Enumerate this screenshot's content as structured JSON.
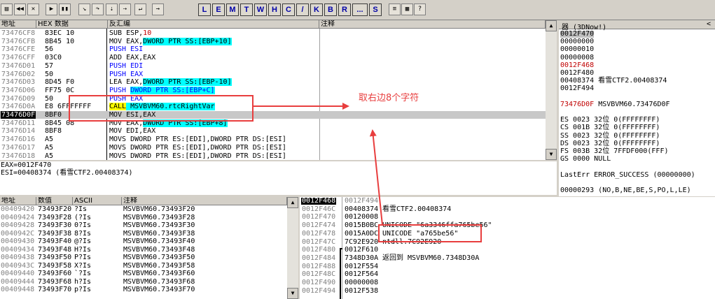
{
  "toolbar": {
    "left_buttons": [
      "open-icon",
      "rewind-icon",
      "close-icon",
      "run-icon",
      "pause-icon",
      "step-into-icon",
      "step-over-icon",
      "trace-into-icon",
      "trace-over-icon",
      "execute-till-return-icon",
      "go-to-icon"
    ],
    "letters": [
      "L",
      "E",
      "M",
      "T",
      "W",
      "H",
      "C",
      "/",
      "K",
      "B",
      "R",
      "...",
      "S"
    ],
    "right_buttons": [
      "list-icon",
      "palette-icon",
      "help-icon"
    ]
  },
  "disasm": {
    "headers": {
      "address": "地址",
      "hex": "HEX 数据",
      "disasm": "反汇编",
      "comment": "注释"
    },
    "rows": [
      {
        "addr": "73476CF8",
        "hex": "83EC 10",
        "pre": "SUB ESP,",
        "hl": "",
        "post": "",
        "num": "10",
        "style": "num"
      },
      {
        "addr": "73476CFB",
        "hex": "8B45 10",
        "pre": "MOV EAX,",
        "hl": "DWORD PTR SS:[EBP+10]",
        "post": "",
        "num": "",
        "style": "cyan"
      },
      {
        "addr": "73476CFE",
        "hex": "56",
        "pre": "PUSH ESI",
        "hl": "",
        "post": "",
        "num": "",
        "style": "blue"
      },
      {
        "addr": "73476CFF",
        "hex": "03C0",
        "pre": "ADD EAX,EAX",
        "hl": "",
        "post": "",
        "num": "",
        "style": "plain"
      },
      {
        "addr": "73476D01",
        "hex": "57",
        "pre": "PUSH EDI",
        "hl": "",
        "post": "",
        "num": "",
        "style": "blue"
      },
      {
        "addr": "73476D02",
        "hex": "50",
        "pre": "PUSH EAX",
        "hl": "",
        "post": "",
        "num": "",
        "style": "blue"
      },
      {
        "addr": "73476D03",
        "hex": "8D45 F0",
        "pre": "LEA EAX,",
        "hl": "DWORD PTR SS:[EBP-10]",
        "post": "",
        "num": "",
        "style": "cyan"
      },
      {
        "addr": "73476D06",
        "hex": "FF75 0C",
        "pre": "PUSH ",
        "hl": "DWORD PTR SS:[EBP+C]",
        "post": "",
        "num": "",
        "style": "cyan-blue"
      },
      {
        "addr": "73476D09",
        "hex": "50",
        "pre": "PUSH EAX",
        "hl": "",
        "post": "",
        "num": "",
        "style": "blue"
      },
      {
        "addr": "73476D0A",
        "hex": "E8 6FFFFFFF",
        "pre": "CALL",
        "hl": " MSVBVM60.rtcRightVar",
        "post": "",
        "num": "",
        "style": "call"
      },
      {
        "addr": "73476D0F",
        "hex": "8BF0",
        "pre": "MOV ESI,EAX",
        "hl": "",
        "post": "",
        "num": "",
        "style": "selected"
      },
      {
        "addr": "73476D11",
        "hex": "8B45 08",
        "pre": "MOV EAX,",
        "hl": "DWORD PTR SS:[EBP+8]",
        "post": "",
        "num": "",
        "style": "cyan"
      },
      {
        "addr": "73476D14",
        "hex": "8BF8",
        "pre": "MOV EDI,EAX",
        "hl": "",
        "post": "",
        "num": "",
        "style": "plain"
      },
      {
        "addr": "73476D16",
        "hex": "A5",
        "pre": "MOVS DWORD PTR ES:[EDI],DWORD PTR DS:[ESI]",
        "hl": "",
        "post": "",
        "num": "",
        "style": "plain"
      },
      {
        "addr": "73476D17",
        "hex": "A5",
        "pre": "MOVS DWORD PTR ES:[EDI],DWORD PTR DS:[ESI]",
        "hl": "",
        "post": "",
        "num": "",
        "style": "plain"
      },
      {
        "addr": "73476D18",
        "hex": "A5",
        "pre": "MOVS DWORD PTR ES:[EDI],DWORD PTR DS:[ESI]",
        "hl": "",
        "post": "",
        "num": "",
        "style": "plain"
      }
    ]
  },
  "info": {
    "line1": "EAX=0012F470",
    "line2": "ESI=00408374 (看雪CTF2.00408374)"
  },
  "registers": {
    "title": "器 (3DNow!)",
    "collapse": "<",
    "lines": [
      {
        "text": "0012F470",
        "style": "sel"
      },
      {
        "text": "00000000",
        "style": "plain"
      },
      {
        "text": "00000010",
        "style": "plain"
      },
      {
        "text": "00000008",
        "style": "plain"
      },
      {
        "text": "0012F468",
        "style": "red"
      },
      {
        "text": "0012F480",
        "style": "plain"
      },
      {
        "text": "00408374 看雪CTF2.00408374",
        "style": "plain"
      },
      {
        "text": "0012F494",
        "style": "plain"
      },
      {
        "text": "",
        "style": "plain"
      },
      {
        "text": "73476D0F MSVBVM60.73476D0F",
        "style": "redaddr"
      },
      {
        "text": "",
        "style": "plain"
      },
      {
        "text": "ES 0023 32位 0(FFFFFFFF)",
        "style": "plain"
      },
      {
        "text": "CS 001B 32位 0(FFFFFFFF)",
        "style": "plain"
      },
      {
        "text": "SS 0023 32位 0(FFFFFFFF)",
        "style": "plain"
      },
      {
        "text": "DS 0023 32位 0(FFFFFFFF)",
        "style": "plain"
      },
      {
        "text": "FS 003B 32位 7FFDF000(FFF)",
        "style": "plain"
      },
      {
        "text": "GS 0000 NULL",
        "style": "plain"
      },
      {
        "text": "",
        "style": "plain"
      },
      {
        "text": "LastErr ERROR_SUCCESS (00000000)",
        "style": "plain"
      },
      {
        "text": "",
        "style": "plain"
      },
      {
        "text": "00000293 (NO,B,NE,BE,S,PO,L,LE)",
        "style": "plain"
      }
    ]
  },
  "dump": {
    "headers": {
      "address": "地址",
      "value": "数值",
      "ascii": "ASCII",
      "comment": "注释"
    },
    "rows": [
      {
        "addr": "00409420",
        "val": "73493F20",
        "ascii": " ?Is",
        "cmt": "MSVBVM60.73493F20"
      },
      {
        "addr": "00409424",
        "val": "73493F28",
        "ascii": "(?Is",
        "cmt": "MSVBVM60.73493F28"
      },
      {
        "addr": "00409428",
        "val": "73493F30",
        "ascii": "0?Is",
        "cmt": "MSVBVM60.73493F30"
      },
      {
        "addr": "0040942C",
        "val": "73493F38",
        "ascii": "8?Is",
        "cmt": "MSVBVM60.73493F38"
      },
      {
        "addr": "00409430",
        "val": "73493F40",
        "ascii": "@?Is",
        "cmt": "MSVBVM60.73493F40"
      },
      {
        "addr": "00409434",
        "val": "73493F48",
        "ascii": "H?Is",
        "cmt": "MSVBVM60.73493F48"
      },
      {
        "addr": "00409438",
        "val": "73493F50",
        "ascii": "P?Is",
        "cmt": "MSVBVM60.73493F50"
      },
      {
        "addr": "0040943C",
        "val": "73493F58",
        "ascii": "X?Is",
        "cmt": "MSVBVM60.73493F58"
      },
      {
        "addr": "00409440",
        "val": "73493F60",
        "ascii": "`?Is",
        "cmt": "MSVBVM60.73493F60"
      },
      {
        "addr": "00409444",
        "val": "73493F68",
        "ascii": "h?Is",
        "cmt": "MSVBVM60.73493F68"
      },
      {
        "addr": "00409448",
        "val": "73493F70",
        "ascii": "p?Is",
        "cmt": "MSVBVM60.73493F70"
      }
    ]
  },
  "stack": {
    "rows": [
      {
        "addr": "0012F468",
        "val": "0012F494",
        "cmt": "",
        "style": "sel"
      },
      {
        "addr": "0012F46C",
        "val": "00408374",
        "cmt": "看雪CTF2.00408374",
        "style": "plain"
      },
      {
        "addr": "0012F470",
        "val": "00120008",
        "cmt": "",
        "style": "plain"
      },
      {
        "addr": "0012F474",
        "val": "0015B0BC",
        "cmt": "UNICODE \"6a3346ffa765be56\"",
        "style": "plain"
      },
      {
        "addr": "0012F478",
        "val": "0015A0DC",
        "cmt": "UNICODE \"a765be56\"",
        "style": "plain"
      },
      {
        "addr": "0012F47C",
        "val": "7C92E920",
        "cmt": "ntdll.7C92E920",
        "style": "plain"
      },
      {
        "addr": "0012F480",
        "val": "0012F610",
        "cmt": "",
        "style": "plain"
      },
      {
        "addr": "0012F484",
        "val": "7348D30A",
        "cmt": "返回到 MSVBVM60.7348D30A",
        "style": "plain"
      },
      {
        "addr": "0012F488",
        "val": "0012F554",
        "cmt": "",
        "style": "plain"
      },
      {
        "addr": "0012F48C",
        "val": "0012F564",
        "cmt": "",
        "style": "plain"
      },
      {
        "addr": "0012F490",
        "val": "00000008",
        "cmt": "",
        "style": "plain"
      },
      {
        "addr": "0012F494",
        "val": "0012F538",
        "cmt": "",
        "style": "plain"
      }
    ]
  },
  "annotation": {
    "text": "取右边8个字符",
    "color": "#e83e3e"
  },
  "scroll": {
    "up": "▲",
    "down": "▼"
  }
}
